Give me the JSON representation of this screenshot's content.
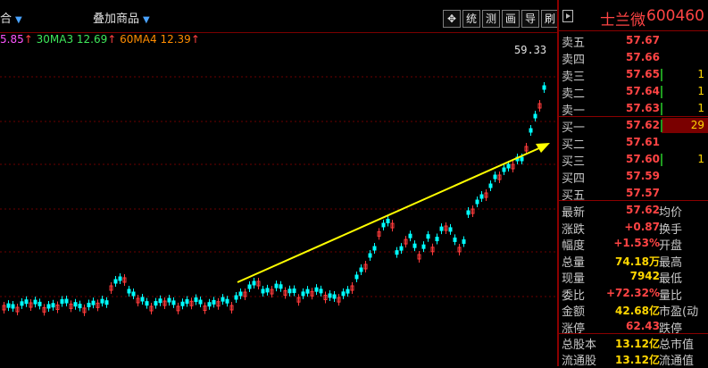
{
  "toolbar": {
    "left_label": "合",
    "overlay_label": "叠加商品",
    "buttons": [
      {
        "label": "✥",
        "name": "move-icon"
      },
      {
        "label": "统",
        "name": "stats-button"
      },
      {
        "label": "测",
        "name": "measure-button"
      },
      {
        "label": "画",
        "name": "draw-button"
      },
      {
        "label": "导",
        "name": "export-button"
      },
      {
        "label": "刷",
        "name": "refresh-button"
      }
    ]
  },
  "ma_legend": {
    "ma_a_value": "5.85",
    "ma3_label": "30MA3",
    "ma3_value": "12.69",
    "ma4_label": "60MA4",
    "ma4_value": "12.39"
  },
  "chart_data": {
    "type": "candlestick",
    "high_label": "59.33",
    "trend_arrow": true,
    "up_color": "#ff3b3b",
    "down_color": "#00ffff",
    "arrow_color": "#ffff00"
  },
  "stock": {
    "name": "士兰微",
    "code": "600460"
  },
  "order_book": {
    "asks": [
      {
        "label": "卖五",
        "price": "57.67",
        "vol": ""
      },
      {
        "label": "卖四",
        "price": "57.66",
        "vol": ""
      },
      {
        "label": "卖三",
        "price": "57.65",
        "vol": "1"
      },
      {
        "label": "卖二",
        "price": "57.64",
        "vol": "1"
      },
      {
        "label": "卖一",
        "price": "57.63",
        "vol": "1"
      }
    ],
    "bids": [
      {
        "label": "买一",
        "price": "57.62",
        "vol": "29"
      },
      {
        "label": "买二",
        "price": "57.61",
        "vol": ""
      },
      {
        "label": "买三",
        "price": "57.60",
        "vol": "1"
      },
      {
        "label": "买四",
        "price": "57.59",
        "vol": ""
      },
      {
        "label": "买五",
        "price": "57.57",
        "vol": ""
      }
    ]
  },
  "quote": [
    {
      "l1": "最新",
      "v": "57.62",
      "l2": "均价"
    },
    {
      "l1": "涨跌",
      "v": "+0.87",
      "l2": "换手"
    },
    {
      "l1": "幅度",
      "v": "+1.53%",
      "l2": "开盘"
    },
    {
      "l1": "总量",
      "v": "74.18万",
      "l2": "最高"
    },
    {
      "l1": "现量",
      "v": "7942",
      "l2": "最低"
    },
    {
      "l1": "委比",
      "v": "+72.32%",
      "l2": "量比"
    },
    {
      "l1": "金额",
      "v": "42.68亿",
      "l2": "市盈(动"
    },
    {
      "l1": "涨停",
      "v": "62.43",
      "l2": "跌停"
    }
  ],
  "capital": [
    {
      "l1": "总股本",
      "v": "13.12亿",
      "l2": "总市值"
    },
    {
      "l1": "流通股",
      "v": "13.12亿",
      "l2": "流通值"
    }
  ]
}
